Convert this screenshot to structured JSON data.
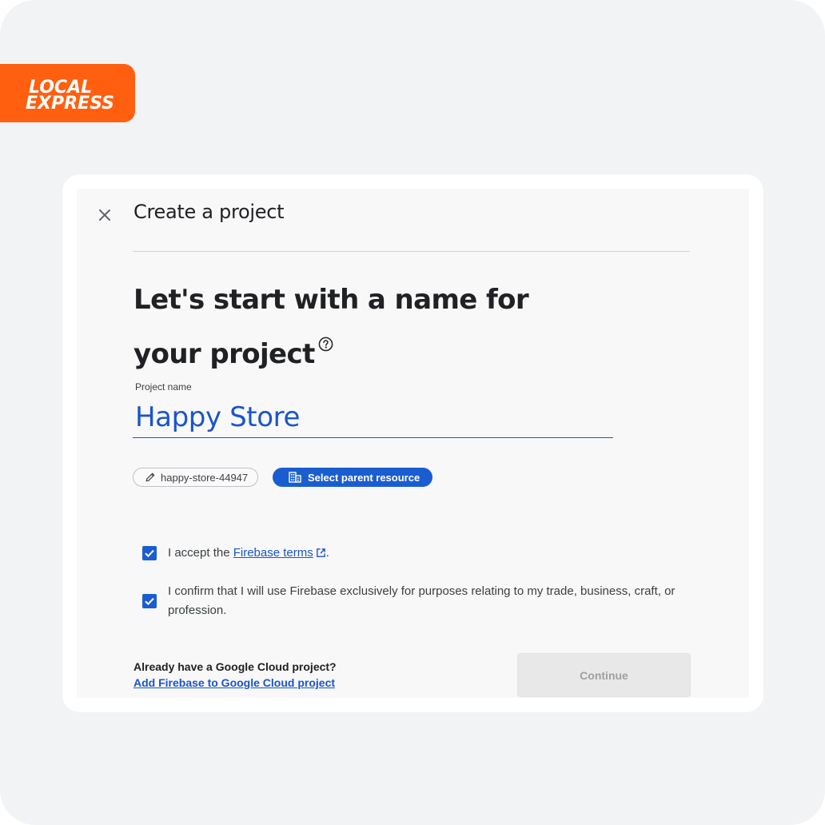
{
  "brand": {
    "logo_line1": "LOCAL",
    "logo_line2": "EXPRESS",
    "color": "#ff5f0f"
  },
  "dialog": {
    "title": "Create a project",
    "close_icon": "close-icon",
    "headline_line1": "Let's start with a name for",
    "headline_line2": "your project",
    "help_icon": "help-circle-icon"
  },
  "project_name": {
    "label": "Project name",
    "value": "Happy Store"
  },
  "chips": {
    "project_id": "happy-store-44947",
    "project_id_icon": "pencil-icon",
    "parent_resource": "Select parent resource",
    "parent_resource_icon": "building-icon"
  },
  "terms": {
    "accept_prefix": "I accept the ",
    "accept_link": "Firebase terms",
    "accept_suffix": ".",
    "accept_checked": true,
    "confirm_text": "I confirm that I will use Firebase exclusively for purposes relating to my trade, business, craft, or profession.",
    "confirm_checked": true
  },
  "footer": {
    "already_text": "Already have a Google Cloud project?",
    "add_link": "Add Firebase to Google Cloud project",
    "continue_label": "Continue"
  },
  "colors": {
    "accent": "#1a5dd0",
    "link": "#1a55c8",
    "background": "#f2f3f5"
  }
}
